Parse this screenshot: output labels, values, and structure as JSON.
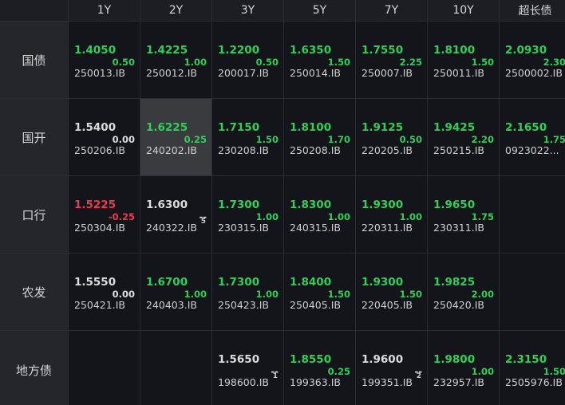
{
  "columns": [
    "1Y",
    "2Y",
    "3Y",
    "5Y",
    "7Y",
    "10Y",
    "超长债"
  ],
  "rows": [
    {
      "name": "国债",
      "cells": [
        {
          "rate": "1.4050",
          "change": "0.50",
          "code": "250013.IB",
          "color": "g"
        },
        {
          "rate": "1.4225",
          "change": "1.00",
          "code": "250012.IB",
          "color": "g"
        },
        {
          "rate": "1.2200",
          "change": "0.50",
          "code": "200017.IB",
          "color": "g"
        },
        {
          "rate": "1.6350",
          "change": "1.50",
          "code": "250014.IB",
          "color": "g"
        },
        {
          "rate": "1.7550",
          "change": "2.25",
          "code": "250007.IB",
          "color": "g"
        },
        {
          "rate": "1.8100",
          "change": "1.50",
          "code": "250011.IB",
          "color": "g"
        },
        {
          "rate": "2.0930",
          "change": "2.30",
          "code": "2500002.IB",
          "color": "g"
        }
      ]
    },
    {
      "name": "国开",
      "cells": [
        {
          "rate": "1.5400",
          "change": "0.00",
          "code": "250206.IB",
          "color": "w"
        },
        {
          "rate": "1.6225",
          "change": "0.25",
          "code": "240202.IB",
          "color": "g",
          "selected": true
        },
        {
          "rate": "1.7150",
          "change": "1.50",
          "code": "230208.IB",
          "color": "g"
        },
        {
          "rate": "1.8100",
          "change": "1.70",
          "code": "250208.IB",
          "color": "g"
        },
        {
          "rate": "1.9125",
          "change": "0.50",
          "code": "220205.IB",
          "color": "g"
        },
        {
          "rate": "1.9425",
          "change": "2.20",
          "code": "250215.IB",
          "color": "g"
        },
        {
          "rate": "2.1650",
          "change": "1.75",
          "code": "0923022...",
          "color": "g"
        }
      ]
    },
    {
      "name": "口行",
      "cells": [
        {
          "rate": "1.5225",
          "change": "-0.25",
          "code": "250304.IB",
          "color": "r"
        },
        {
          "rate": "1.6300",
          "change": "--",
          "change_sub": "5",
          "code": "240322.IB",
          "color": "w"
        },
        {
          "rate": "1.7300",
          "change": "1.00",
          "code": "230315.IB",
          "color": "g"
        },
        {
          "rate": "1.8300",
          "change": "1.00",
          "code": "240315.IB",
          "color": "g"
        },
        {
          "rate": "1.9300",
          "change": "1.00",
          "code": "220311.IB",
          "color": "g"
        },
        {
          "rate": "1.9650",
          "change": "1.75",
          "code": "230311.IB",
          "color": "g"
        },
        null
      ]
    },
    {
      "name": "农发",
      "cells": [
        {
          "rate": "1.5550",
          "change": "0.00",
          "code": "250421.IB",
          "color": "w"
        },
        {
          "rate": "1.6700",
          "change": "1.00",
          "code": "240403.IB",
          "color": "g"
        },
        {
          "rate": "1.7300",
          "change": "1.00",
          "code": "250423.IB",
          "color": "g"
        },
        {
          "rate": "1.8400",
          "change": "1.50",
          "code": "250405.IB",
          "color": "g"
        },
        {
          "rate": "1.9300",
          "change": "1.50",
          "code": "220405.IB",
          "color": "g"
        },
        {
          "rate": "1.9825",
          "change": "2.00",
          "code": "250420.IB",
          "color": "g"
        },
        null
      ]
    },
    {
      "name": "地方债",
      "cells": [
        null,
        null,
        {
          "rate": "1.5650",
          "change": "--",
          "change_sub": "1",
          "code": "198600.IB",
          "color": "w"
        },
        {
          "rate": "1.8550",
          "change": "0.25",
          "code": "199363.IB",
          "color": "g"
        },
        {
          "rate": "1.9600",
          "change": "--",
          "change_sub": "2",
          "code": "199351.IB",
          "color": "w"
        },
        {
          "rate": "1.9800",
          "change": "1.00",
          "code": "232957.IB",
          "color": "g"
        },
        {
          "rate": "2.3150",
          "change": "1.50",
          "code": "2505976.IB",
          "color": "g"
        }
      ]
    }
  ]
}
